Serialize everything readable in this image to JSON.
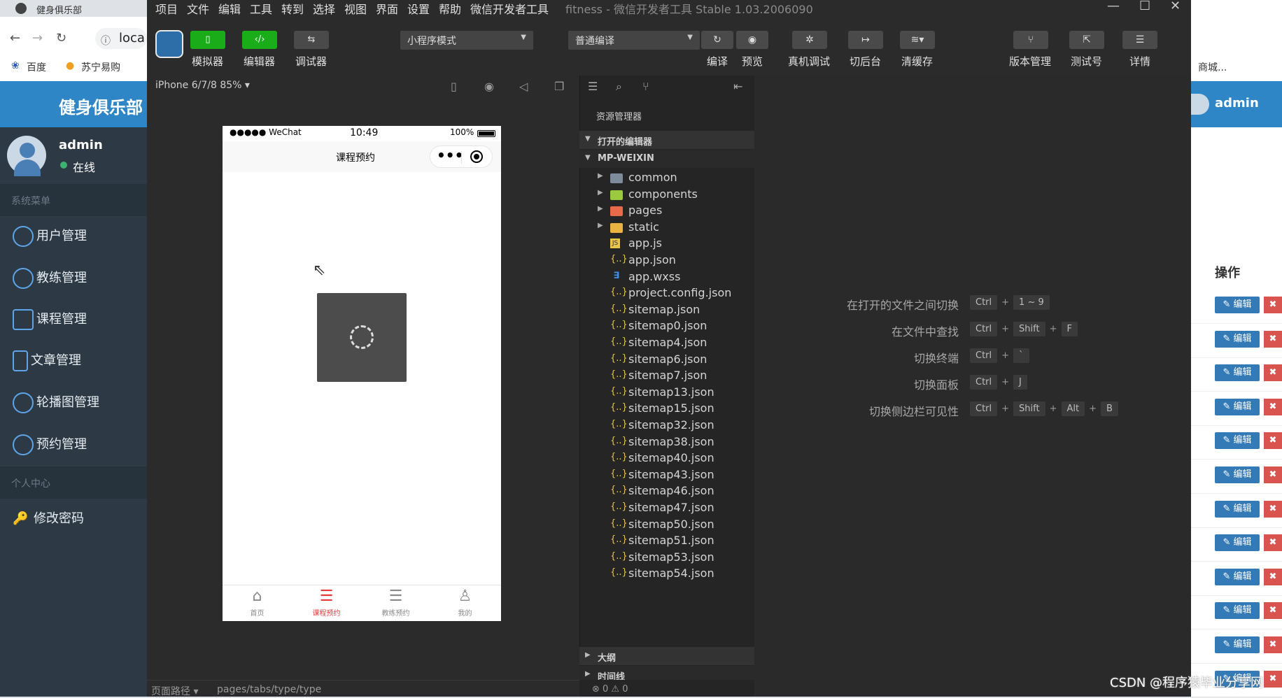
{
  "browser": {
    "tab_title": "健身俱乐部",
    "url_partial": "loca",
    "bookmarks": [
      "百度",
      "苏宁易购"
    ],
    "right_bookmark": "商城..."
  },
  "admin": {
    "header_title": "健身俱乐部",
    "user_name": "admin",
    "status": "在线",
    "section_system": "系统菜单",
    "section_personal": "个人中心",
    "menu": [
      {
        "label": "用户管理",
        "icon": "user-icon"
      },
      {
        "label": "教练管理",
        "icon": "coach-icon"
      },
      {
        "label": "课程管理",
        "icon": "calendar-icon"
      },
      {
        "label": "文章管理",
        "icon": "document-icon"
      },
      {
        "label": "轮播图管理",
        "icon": "carousel-icon"
      },
      {
        "label": "预约管理",
        "icon": "clock-icon"
      }
    ],
    "change_password": "修改密码",
    "right_user": "admin",
    "op_header": "操作",
    "edit_label": "编辑",
    "delete_label": "✖"
  },
  "ide": {
    "menu": [
      "项目",
      "文件",
      "编辑",
      "工具",
      "转到",
      "选择",
      "视图",
      "界面",
      "设置",
      "帮助",
      "微信开发者工具"
    ],
    "window_title": "fitness - 微信开发者工具 Stable 1.03.2006090",
    "toolbar": {
      "simulator": "模拟器",
      "editor": "编辑器",
      "debugger": "调试器",
      "mode": "小程序模式",
      "compile_mode": "普通编译",
      "compile": "编译",
      "preview": "预览",
      "remote_debug": "真机调试",
      "background": "切后台",
      "clear_cache": "清缓存",
      "version_mgmt": "版本管理",
      "test_account": "测试号",
      "details": "详情"
    },
    "device": "iPhone 6/7/8 85% ▾",
    "footer_path_label": "页面路径 ▾",
    "footer_path": "pages/tabs/type/type",
    "status_counts": "⊗ 0 ⚠ 0"
  },
  "phone": {
    "carrier": "●●●●● WeChat",
    "time": "10:49",
    "battery": "100%",
    "title": "课程预约",
    "tabs": [
      {
        "label": "首页",
        "icon": "home-icon",
        "active": false
      },
      {
        "label": "课程预约",
        "icon": "list-icon",
        "active": true
      },
      {
        "label": "教练预约",
        "icon": "list-icon",
        "active": false
      },
      {
        "label": "我的",
        "icon": "person-icon",
        "active": false
      }
    ]
  },
  "explorer": {
    "title": "资源管理器",
    "open_editors": "打开的编辑器",
    "root": "MP-WEIXIN",
    "folders": [
      "common",
      "components",
      "pages",
      "static"
    ],
    "files": [
      "app.js",
      "app.json",
      "app.wxss",
      "project.config.json",
      "sitemap.json",
      "sitemap0.json",
      "sitemap4.json",
      "sitemap6.json",
      "sitemap7.json",
      "sitemap13.json",
      "sitemap15.json",
      "sitemap32.json",
      "sitemap38.json",
      "sitemap40.json",
      "sitemap43.json",
      "sitemap46.json",
      "sitemap47.json",
      "sitemap50.json",
      "sitemap51.json",
      "sitemap53.json",
      "sitemap54.json"
    ],
    "outline": "大纲",
    "timeline": "时间线"
  },
  "shortcuts": [
    {
      "label": "在打开的文件之间切换",
      "keys": [
        "Ctrl",
        "1 ~ 9"
      ]
    },
    {
      "label": "在文件中查找",
      "keys": [
        "Ctrl",
        "Shift",
        "F"
      ]
    },
    {
      "label": "切换终端",
      "keys": [
        "Ctrl",
        "`"
      ]
    },
    {
      "label": "切换面板",
      "keys": [
        "Ctrl",
        "J"
      ]
    },
    {
      "label": "切换侧边栏可见性",
      "keys": [
        "Ctrl",
        "Shift",
        "Alt",
        "B"
      ]
    }
  ],
  "watermark": "CSDN @程序猿毕业分享网",
  "colors": {
    "accent_green": "#1aad19",
    "admin_blue": "#2f86c6",
    "admin_sidebar": "#2d3a46",
    "active_tab_red": "#e4393c"
  }
}
